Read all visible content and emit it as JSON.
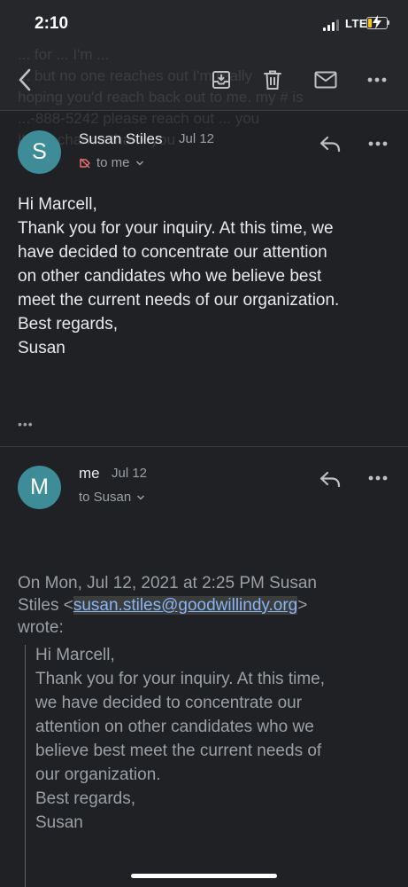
{
  "status_bar": {
    "time": "2:10",
    "carrier": "LTE",
    "battery_level": 0.2,
    "battery_color": "#f5c518"
  },
  "app_bar": {
    "icons": [
      "back-arrow-icon",
      "archive-icon",
      "trash-icon",
      "mail-icon",
      "more-icon"
    ],
    "background_ghost_text": [
      "... for ... I'm ...",
      "... but no one reaches out I'm really",
      "hoping you'd reach back out to me. my # is",
      "...-888-5242 please reach out ... you",
      "I've a chance thank you"
    ]
  },
  "messages": [
    {
      "avatar_letter": "S",
      "avatar_color": "#3e8c97",
      "sender": "Susan Stiles",
      "date": "Jul 12",
      "recipient": "to me",
      "body": [
        "Hi Marcell,",
        "Thank you for your inquiry.  At this time, we",
        "have decided to concentrate our attention",
        "on other candidates who we believe best",
        "meet the current needs of our organization.",
        "Best regards,",
        "Susan"
      ],
      "trimmed_indicator": "•••"
    },
    {
      "avatar_letter": "M",
      "avatar_color": "#3e8c97",
      "sender": "me",
      "date": "Jul 12",
      "recipient": "to Susan",
      "quote_header": {
        "line1": "On Mon, Jul 12, 2021 at 2:25 PM Susan",
        "line2_prefix": "Stiles <",
        "email": "susan.stiles@goodwillindy.org",
        "line2_suffix": ">",
        "line3": "wrote:"
      },
      "quoted_body": [
        "Hi Marcell,",
        "Thank you for your inquiry.  At this time,",
        "we have decided to concentrate our",
        "attention on other candidates who we",
        "believe best meet the current needs of",
        "our organization.",
        "Best regards,",
        "Susan"
      ]
    }
  ]
}
